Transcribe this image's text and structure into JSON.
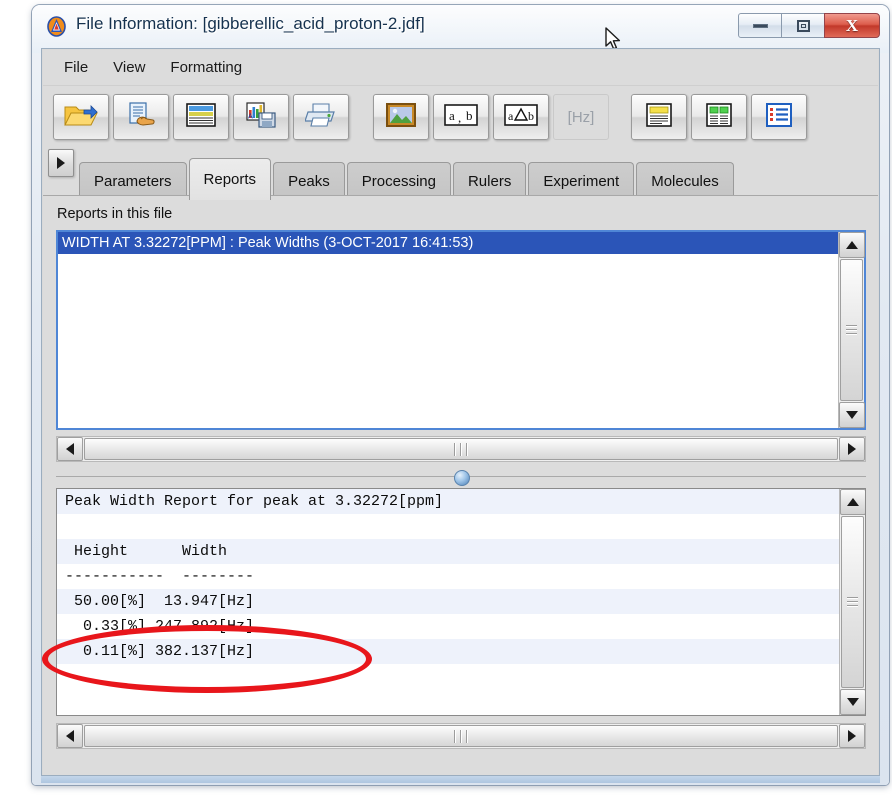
{
  "window": {
    "title": "File Information: [gibberellic_acid_proton-2.jdf]",
    "app_icon": "jeol-delta-icon",
    "minimize_label": "",
    "maximize_label": "",
    "close_label": "X"
  },
  "menubar": {
    "items": [
      {
        "label": "File"
      },
      {
        "label": "View"
      },
      {
        "label": "Formatting"
      }
    ]
  },
  "toolbar": {
    "buttons": [
      {
        "icon": "open-folder-icon",
        "label": "",
        "enabled": true
      },
      {
        "icon": "document-hand-icon",
        "label": "",
        "enabled": true
      },
      {
        "icon": "table-view-icon",
        "label": "",
        "enabled": true
      },
      {
        "icon": "chart-save-icon",
        "label": "",
        "enabled": true
      },
      {
        "icon": "printer-icon",
        "label": "",
        "enabled": true
      },
      {
        "icon": "picture-icon",
        "label": "",
        "enabled": true
      },
      {
        "icon": "ab-text-icon",
        "label": "a , b",
        "enabled": true
      },
      {
        "icon": "a-delta-b-icon",
        "label": "a△b",
        "enabled": true
      },
      {
        "icon": "hertz-icon",
        "label": "[Hz]",
        "enabled": false
      },
      {
        "icon": "report-yellow-icon",
        "label": "",
        "enabled": true
      },
      {
        "icon": "table-green-icon",
        "label": "",
        "enabled": true
      },
      {
        "icon": "list-blue-icon",
        "label": "",
        "enabled": true
      }
    ]
  },
  "tabs": {
    "scroll_icon": "scroll-right-icon",
    "items": [
      {
        "label": "Parameters",
        "active": false
      },
      {
        "label": "Reports",
        "active": true
      },
      {
        "label": "Peaks",
        "active": false
      },
      {
        "label": "Processing",
        "active": false
      },
      {
        "label": "Rulers",
        "active": false
      },
      {
        "label": "Experiment",
        "active": false
      },
      {
        "label": "Molecules",
        "active": false
      }
    ]
  },
  "reports_panel": {
    "label": "Reports in this file",
    "list": [
      {
        "text": "WIDTH AT 3.32272[PPM] : Peak Widths  (3-OCT-2017 16:41:53)",
        "selected": true
      }
    ]
  },
  "report_text": {
    "lines": [
      "Peak Width Report for peak at 3.32272[ppm]",
      "",
      " Height      Width",
      "-----------  --------",
      " 50.00[%]  13.947[Hz]",
      "  0.33[%] 247.892[Hz]",
      "  0.11[%] 382.137[Hz]"
    ]
  },
  "annotation": {
    "shape": "red-ellipse",
    "color": "#e8161b",
    "targets_line": " 50.00[%]  13.947[Hz]"
  },
  "scrollbars": {
    "up_icon": "triangle-up-icon",
    "down_icon": "triangle-down-icon",
    "left_icon": "triangle-left-icon",
    "right_icon": "triangle-right-icon"
  },
  "splitter": {
    "grip_icon": "splitter-grip-icon"
  }
}
